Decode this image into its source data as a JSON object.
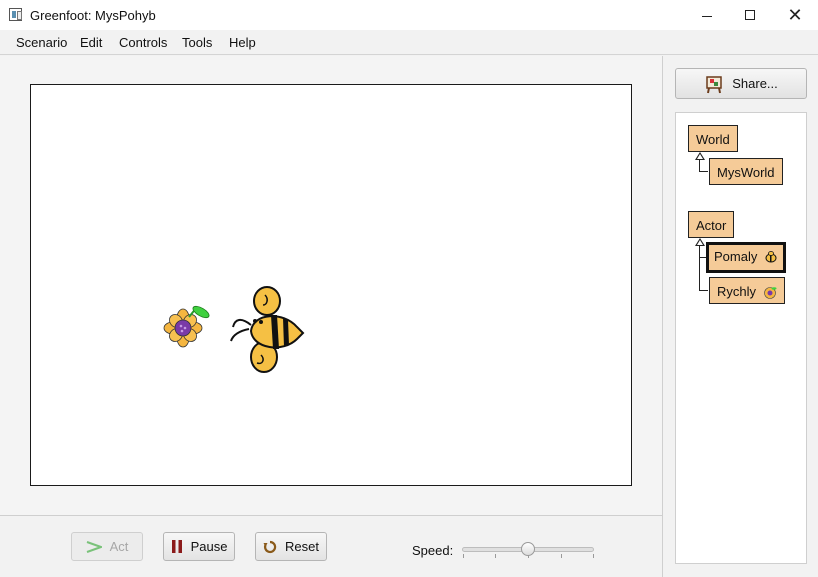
{
  "window": {
    "title": "Greenfoot: MysPohyb",
    "controls": {
      "minimize": "minimize",
      "maximize": "maximize",
      "close": "✕"
    }
  },
  "menu": [
    "Scenario",
    "Edit",
    "Controls",
    "Tools",
    "Help"
  ],
  "share": {
    "label": "Share..."
  },
  "classes": {
    "world_base": "World",
    "world_sub": "MysWorld",
    "actor_base": "Actor",
    "actor_sub1": "Pomaly",
    "actor_sub2": "Rychly",
    "selected": "Pomaly"
  },
  "world": {
    "actors": [
      {
        "name": "flower",
        "icon": "flower-icon"
      },
      {
        "name": "bee",
        "icon": "bee-icon"
      }
    ]
  },
  "controls": {
    "act_label": "Act",
    "act_enabled": false,
    "pause_label": "Pause",
    "reset_label": "Reset",
    "speed_label": "Speed:",
    "speed_value": 0.5
  },
  "colors": {
    "class_box": "#f5cb98",
    "world_bg": "#ffffff",
    "pause_icon": "#8b1a1a",
    "reset_icon": "#8a5a1a",
    "act_icon": "#7ac27a"
  }
}
